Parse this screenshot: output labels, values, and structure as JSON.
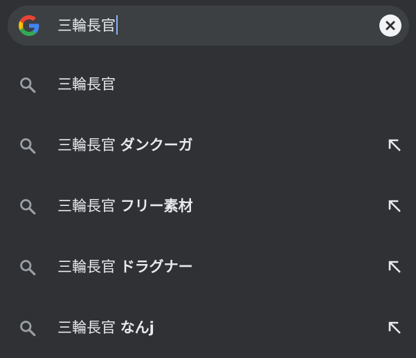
{
  "search": {
    "query": "三輪長官",
    "logo_icon": "google-g-icon",
    "clear_icon": "clear-icon"
  },
  "suggestions": [
    {
      "prefix": "三輪長官",
      "completion": "",
      "has_fill_arrow": false
    },
    {
      "prefix": "三輪長官",
      "completion": "ダンクーガ",
      "has_fill_arrow": true
    },
    {
      "prefix": "三輪長官",
      "completion": "フリー素材",
      "has_fill_arrow": true
    },
    {
      "prefix": "三輪長官",
      "completion": "ドラグナー",
      "has_fill_arrow": true
    },
    {
      "prefix": "三輪長官",
      "completion": "なんj",
      "has_fill_arrow": true
    }
  ],
  "colors": {
    "background": "#303134",
    "search_bar": "#3c4043",
    "text": "#e8eaed",
    "icon": "#9aa0a6",
    "caret": "#8ab4f8"
  }
}
